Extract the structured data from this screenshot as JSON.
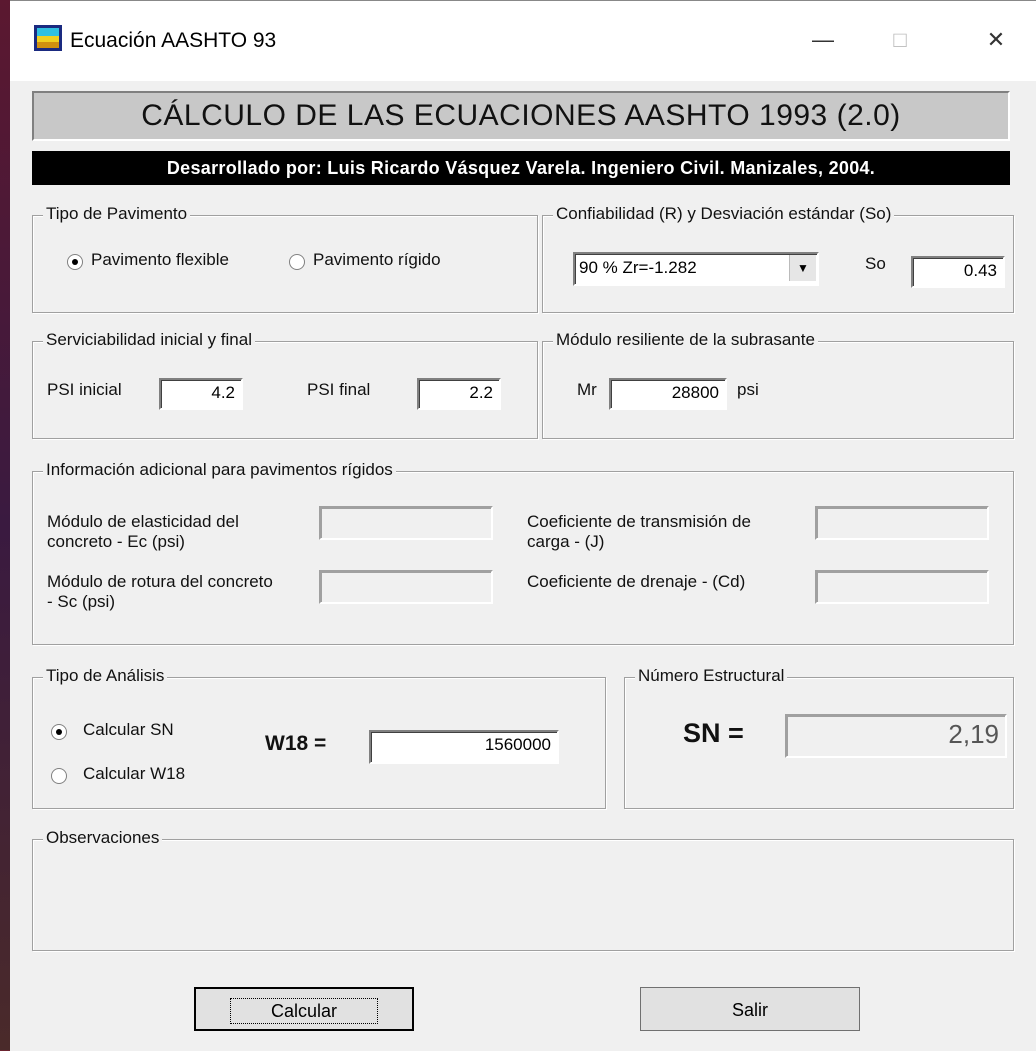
{
  "window": {
    "title": "Ecuación AASHTO 93",
    "minimize": "—",
    "maximize": "□",
    "close": "✕"
  },
  "header": {
    "title": "CÁLCULO DE LAS ECUACIONES AASHTO 1993 (2.0)",
    "author": "Desarrollado por: Luis Ricardo Vásquez Varela.  Ingeniero Civil. Manizales, 2004."
  },
  "pavement": {
    "legend": "Tipo de Pavimento",
    "flexible": "Pavimento flexible",
    "rigid": "Pavimento rígido",
    "selected": "flexible"
  },
  "reliability": {
    "legend": "Confiabilidad (R) y Desviación estándar (So)",
    "selected": "90 %  Zr=-1.282",
    "so_label": "So",
    "so_value": "0.43"
  },
  "serviceability": {
    "legend": "Serviciabilidad inicial y final",
    "initial_label": "PSI inicial",
    "initial_value": "4.2",
    "final_label": "PSI final",
    "final_value": "2.2"
  },
  "modulus": {
    "legend": "Módulo resiliente de la subrasante",
    "label": "Mr",
    "value": "28800",
    "unit": "psi"
  },
  "rigid_info": {
    "legend": "Información adicional para pavimentos rígidos",
    "ec_label": "Módulo de elasticidad del concreto - Ec (psi)",
    "sc_label": "Módulo de rotura del concreto - Sc (psi)",
    "j_label": "Coeficiente de transmisión de carga - (J)",
    "cd_label": "Coeficiente de drenaje - (Cd)"
  },
  "analysis": {
    "legend": "Tipo de Análisis",
    "option_sn": "Calcular SN",
    "option_w18": "Calcular W18",
    "selected": "sn",
    "w18_label": "W18 =",
    "w18_value": "1560000"
  },
  "structural": {
    "legend": "Número Estructural",
    "label": "SN =",
    "value": "2,19"
  },
  "observations": {
    "legend": "Observaciones"
  },
  "buttons": {
    "calculate": "Calcular",
    "exit": "Salir"
  }
}
